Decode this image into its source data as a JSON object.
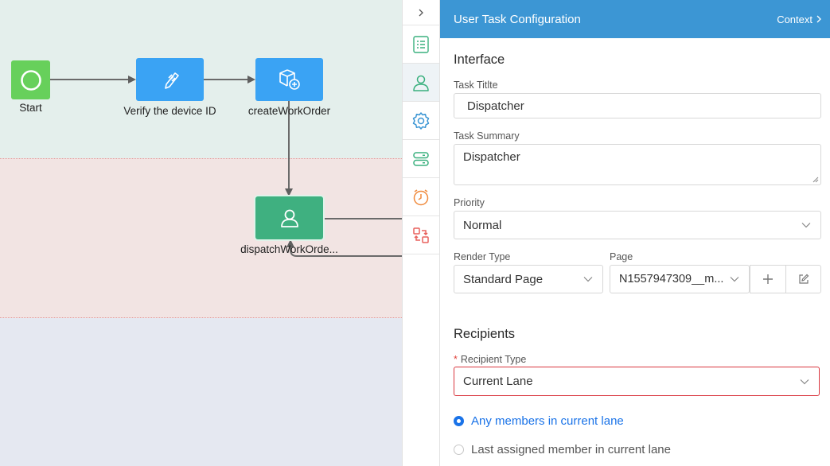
{
  "canvas": {
    "nodes": {
      "start": {
        "label": "Start",
        "color": "#67d05b"
      },
      "verify": {
        "label": "Verify the device ID",
        "color": "#3aa3f4"
      },
      "create": {
        "label": "createWorkOrder",
        "color": "#3aa3f4"
      },
      "dispatch": {
        "label": "dispatchWorkOrde...",
        "color": "#3fb080"
      }
    },
    "lane_colors": [
      "#e4efec",
      "#f2e4e3",
      "#e5e8f1"
    ]
  },
  "toolbar": {
    "items": [
      {
        "icon": "chevron-right-icon"
      },
      {
        "icon": "list-icon"
      },
      {
        "icon": "user-icon",
        "active": true
      },
      {
        "icon": "gear-icon"
      },
      {
        "icon": "server-icon"
      },
      {
        "icon": "clock-icon"
      },
      {
        "icon": "swap-icon"
      }
    ]
  },
  "panel": {
    "title": "User Task Configuration",
    "context_label": "Context",
    "header_color": "#3c96d4",
    "interface": {
      "section_title": "Interface",
      "task_title_label": "Task Titlte",
      "task_title_value": "Dispatcher",
      "task_summary_label": "Task Summary",
      "task_summary_value": "Dispatcher",
      "priority_label": "Priority",
      "priority_value": "Normal",
      "render_type_label": "Render Type",
      "render_type_value": "Standard Page",
      "page_label": "Page",
      "page_value": "N1557947309__m..."
    },
    "recipients": {
      "section_title": "Recipients",
      "recipient_type_label": "Recipient Type",
      "required_mark": "*",
      "recipient_type_value": "Current Lane",
      "options": [
        {
          "label": "Any members in current lane",
          "selected": true
        },
        {
          "label": "Last assigned member in current lane",
          "selected": false
        }
      ]
    }
  }
}
